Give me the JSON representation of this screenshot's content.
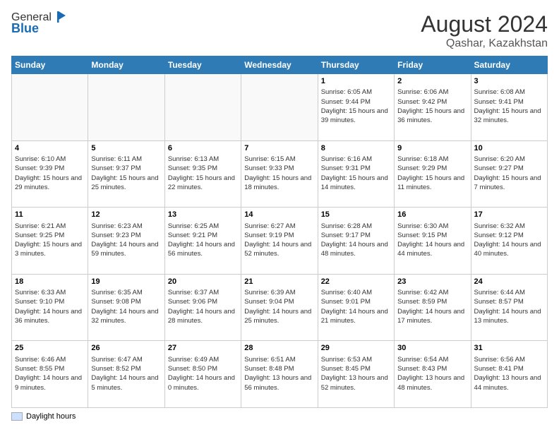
{
  "header": {
    "logo_general": "General",
    "logo_blue": "Blue",
    "month_title": "August 2024",
    "location": "Qashar, Kazakhstan"
  },
  "days_of_week": [
    "Sunday",
    "Monday",
    "Tuesday",
    "Wednesday",
    "Thursday",
    "Friday",
    "Saturday"
  ],
  "legend_label": "Daylight hours",
  "weeks": [
    [
      {
        "day": "",
        "info": ""
      },
      {
        "day": "",
        "info": ""
      },
      {
        "day": "",
        "info": ""
      },
      {
        "day": "",
        "info": ""
      },
      {
        "day": "1",
        "info": "Sunrise: 6:05 AM\nSunset: 9:44 PM\nDaylight: 15 hours and 39 minutes."
      },
      {
        "day": "2",
        "info": "Sunrise: 6:06 AM\nSunset: 9:42 PM\nDaylight: 15 hours and 36 minutes."
      },
      {
        "day": "3",
        "info": "Sunrise: 6:08 AM\nSunset: 9:41 PM\nDaylight: 15 hours and 32 minutes."
      }
    ],
    [
      {
        "day": "4",
        "info": "Sunrise: 6:10 AM\nSunset: 9:39 PM\nDaylight: 15 hours and 29 minutes."
      },
      {
        "day": "5",
        "info": "Sunrise: 6:11 AM\nSunset: 9:37 PM\nDaylight: 15 hours and 25 minutes."
      },
      {
        "day": "6",
        "info": "Sunrise: 6:13 AM\nSunset: 9:35 PM\nDaylight: 15 hours and 22 minutes."
      },
      {
        "day": "7",
        "info": "Sunrise: 6:15 AM\nSunset: 9:33 PM\nDaylight: 15 hours and 18 minutes."
      },
      {
        "day": "8",
        "info": "Sunrise: 6:16 AM\nSunset: 9:31 PM\nDaylight: 15 hours and 14 minutes."
      },
      {
        "day": "9",
        "info": "Sunrise: 6:18 AM\nSunset: 9:29 PM\nDaylight: 15 hours and 11 minutes."
      },
      {
        "day": "10",
        "info": "Sunrise: 6:20 AM\nSunset: 9:27 PM\nDaylight: 15 hours and 7 minutes."
      }
    ],
    [
      {
        "day": "11",
        "info": "Sunrise: 6:21 AM\nSunset: 9:25 PM\nDaylight: 15 hours and 3 minutes."
      },
      {
        "day": "12",
        "info": "Sunrise: 6:23 AM\nSunset: 9:23 PM\nDaylight: 14 hours and 59 minutes."
      },
      {
        "day": "13",
        "info": "Sunrise: 6:25 AM\nSunset: 9:21 PM\nDaylight: 14 hours and 56 minutes."
      },
      {
        "day": "14",
        "info": "Sunrise: 6:27 AM\nSunset: 9:19 PM\nDaylight: 14 hours and 52 minutes."
      },
      {
        "day": "15",
        "info": "Sunrise: 6:28 AM\nSunset: 9:17 PM\nDaylight: 14 hours and 48 minutes."
      },
      {
        "day": "16",
        "info": "Sunrise: 6:30 AM\nSunset: 9:15 PM\nDaylight: 14 hours and 44 minutes."
      },
      {
        "day": "17",
        "info": "Sunrise: 6:32 AM\nSunset: 9:12 PM\nDaylight: 14 hours and 40 minutes."
      }
    ],
    [
      {
        "day": "18",
        "info": "Sunrise: 6:33 AM\nSunset: 9:10 PM\nDaylight: 14 hours and 36 minutes."
      },
      {
        "day": "19",
        "info": "Sunrise: 6:35 AM\nSunset: 9:08 PM\nDaylight: 14 hours and 32 minutes."
      },
      {
        "day": "20",
        "info": "Sunrise: 6:37 AM\nSunset: 9:06 PM\nDaylight: 14 hours and 28 minutes."
      },
      {
        "day": "21",
        "info": "Sunrise: 6:39 AM\nSunset: 9:04 PM\nDaylight: 14 hours and 25 minutes."
      },
      {
        "day": "22",
        "info": "Sunrise: 6:40 AM\nSunset: 9:01 PM\nDaylight: 14 hours and 21 minutes."
      },
      {
        "day": "23",
        "info": "Sunrise: 6:42 AM\nSunset: 8:59 PM\nDaylight: 14 hours and 17 minutes."
      },
      {
        "day": "24",
        "info": "Sunrise: 6:44 AM\nSunset: 8:57 PM\nDaylight: 14 hours and 13 minutes."
      }
    ],
    [
      {
        "day": "25",
        "info": "Sunrise: 6:46 AM\nSunset: 8:55 PM\nDaylight: 14 hours and 9 minutes."
      },
      {
        "day": "26",
        "info": "Sunrise: 6:47 AM\nSunset: 8:52 PM\nDaylight: 14 hours and 5 minutes."
      },
      {
        "day": "27",
        "info": "Sunrise: 6:49 AM\nSunset: 8:50 PM\nDaylight: 14 hours and 0 minutes."
      },
      {
        "day": "28",
        "info": "Sunrise: 6:51 AM\nSunset: 8:48 PM\nDaylight: 13 hours and 56 minutes."
      },
      {
        "day": "29",
        "info": "Sunrise: 6:53 AM\nSunset: 8:45 PM\nDaylight: 13 hours and 52 minutes."
      },
      {
        "day": "30",
        "info": "Sunrise: 6:54 AM\nSunset: 8:43 PM\nDaylight: 13 hours and 48 minutes."
      },
      {
        "day": "31",
        "info": "Sunrise: 6:56 AM\nSunset: 8:41 PM\nDaylight: 13 hours and 44 minutes."
      }
    ]
  ]
}
